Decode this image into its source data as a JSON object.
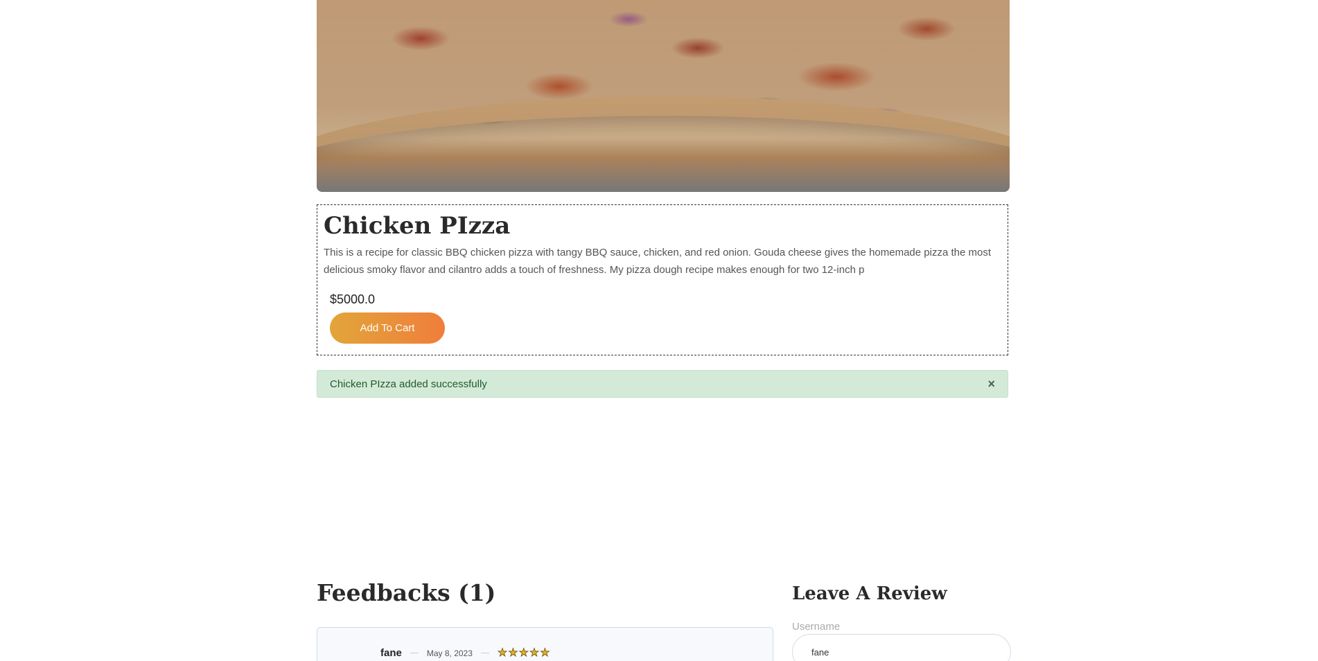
{
  "product": {
    "image_alt": "pizza-photo",
    "title": "Chicken PIzza",
    "description": "This is a recipe for classic BBQ chicken pizza with tangy BBQ sauce, chicken, and red onion. Gouda cheese gives the homemade pizza the most delicious smoky flavor and cilantro adds a touch of freshness. My pizza dough recipe makes enough for two 12-inch p",
    "price": "$5000.0",
    "add_to_cart_label": "Add To Cart"
  },
  "alert": {
    "message": "Chicken PIzza added successfully",
    "close_symbol": "×",
    "color": "#d4ead8"
  },
  "feedbacks": {
    "title": "Feedbacks (1)",
    "items": [
      {
        "username": "fane",
        "date": "May 8, 2023",
        "rating": 5
      }
    ]
  },
  "review_form": {
    "title": "Leave A Review",
    "username_label": "Username",
    "username_value": "fane"
  },
  "colors": {
    "button_gradient_start": "#e2a53a",
    "button_gradient_end": "#ef7e3b",
    "star": "#e7b21c"
  }
}
